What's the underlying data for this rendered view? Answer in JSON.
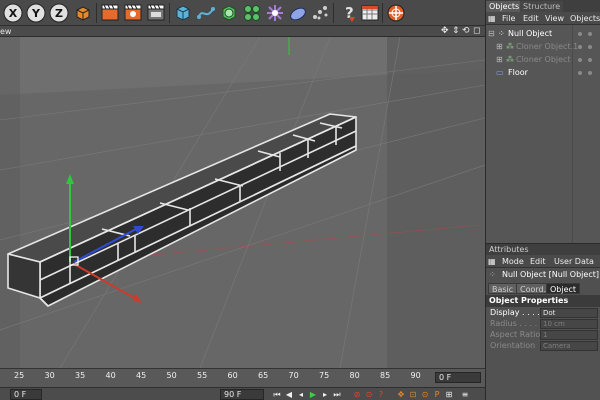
{
  "toolbar": {
    "axis_x": "X",
    "axis_y": "Y",
    "axis_z": "Z"
  },
  "viewport": {
    "menu_fragment": "ew"
  },
  "timeline": {
    "ticks": [
      "25",
      "30",
      "35",
      "40",
      "45",
      "50",
      "55",
      "60",
      "65",
      "70",
      "75",
      "80",
      "85",
      "90"
    ],
    "current_frame": "0 F"
  },
  "transport": {
    "start_field": "0 F",
    "end_field": "90 F"
  },
  "objects_panel": {
    "tabs": [
      "Objects",
      "Structure"
    ],
    "menu": [
      "File",
      "Edit",
      "View",
      "Objects"
    ],
    "items": [
      {
        "label": "Null Object",
        "color": "#ffffff"
      },
      {
        "label": "Cloner Object.1",
        "color": "#8a8a8a"
      },
      {
        "label": "Cloner Object",
        "color": "#8a8a8a"
      },
      {
        "label": "Floor",
        "color": "#ffffff"
      }
    ]
  },
  "attributes_panel": {
    "header": "Attributes",
    "menu": [
      "Mode",
      "Edit",
      "User Data"
    ],
    "title": "Null Object [Null Object]",
    "tabs": [
      "Basic",
      "Coord.",
      "Object"
    ],
    "section": "Object Properties",
    "props": [
      {
        "label": "Display . . . .",
        "value": "Dot",
        "active": true
      },
      {
        "label": "Radius . . . . .",
        "value": "10 cm",
        "active": false
      },
      {
        "label": "Aspect Ratio",
        "value": "1",
        "active": false
      },
      {
        "label": "Orientation",
        "value": "Camera",
        "active": false
      }
    ]
  },
  "colors": {
    "accent_red": "#cc3b2b",
    "axis_green": "#2ec83c",
    "axis_blue": "#2e4bd6",
    "brick": "#3a3a3a"
  }
}
